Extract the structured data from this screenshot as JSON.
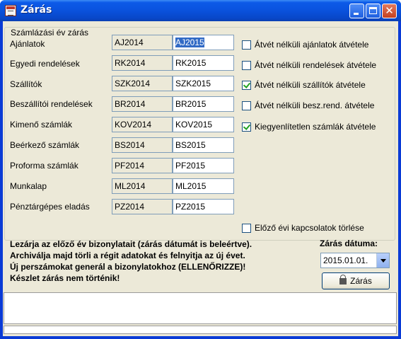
{
  "window": {
    "title": "Zárás"
  },
  "group": {
    "label": "Számlázási év zárás"
  },
  "rows": [
    {
      "label": "Ajánlatok",
      "old": "AJ2014",
      "new": "AJ2015"
    },
    {
      "label": "Egyedi rendelések",
      "old": "RK2014",
      "new": "RK2015"
    },
    {
      "label": "Szállítók",
      "old": "SZK2014",
      "new": "SZK2015"
    },
    {
      "label": "Beszállítói rendelések",
      "old": "BR2014",
      "new": "BR2015"
    },
    {
      "label": "Kimenő számlák",
      "old": "KOV2014",
      "new": "KOV2015"
    },
    {
      "label": "Beérkező számlák",
      "old": "BS2014",
      "new": "BS2015"
    },
    {
      "label": "Proforma számlák",
      "old": "PF2014",
      "new": "PF2015"
    },
    {
      "label": "Munkalap",
      "old": "ML2014",
      "new": "ML2015"
    },
    {
      "label": "Pénztárgépes eladás",
      "old": "PZ2014",
      "new": "PZ2015"
    }
  ],
  "options": [
    {
      "label": "Átvét nélküli ajánlatok átvétele",
      "checked": false
    },
    {
      "label": "Átvét nélküli rendelések átvétele",
      "checked": false
    },
    {
      "label": "Átvét nélküli szállítók átvétele",
      "checked": true
    },
    {
      "label": "Átvét nélküli besz.rend. átvétele",
      "checked": false
    },
    {
      "label": "Kiegyenlítetlen számlák átvétele",
      "checked": true
    }
  ],
  "delete_option": {
    "label": "Előző évi kapcsolatok törlése",
    "checked": false
  },
  "notice": [
    "Lezárja az előző év bizonylatait (zárás dátumát is beleértve).",
    "Archiválja majd törli a régit adatokat és felnyitja az új évet.",
    "Új perszámokat generál a bizonylatokhoz (ELLENŐRIZZE)!",
    "Készlet zárás nem történik!"
  ],
  "closing_date": {
    "label": "Zárás dátuma:",
    "value": "2015.01.01."
  },
  "close_button": {
    "label": "Zárás",
    "icon": "lock-icon"
  }
}
